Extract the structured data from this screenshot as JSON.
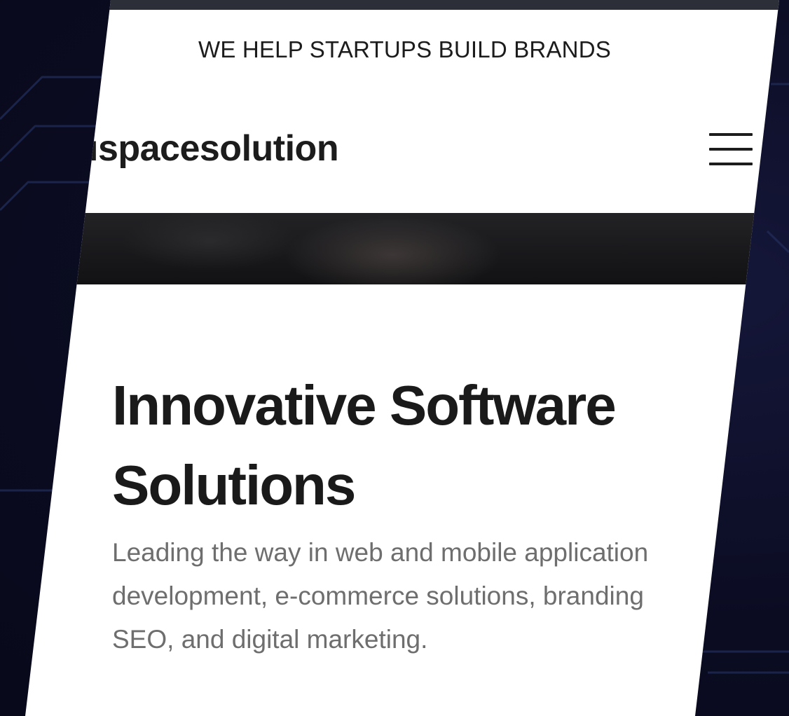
{
  "header": {
    "tagline": "WE HELP STARTUPS BUILD BRANDS",
    "brand_name": "ıspacesolution",
    "menu_icon": "hamburger-menu-icon"
  },
  "hero": {
    "title": "Innovative Software Solutions",
    "description_lines": [
      "Leading the way in web and mobile application",
      "development, e-commerce solutions, branding",
      "SEO, and digital marketing."
    ]
  },
  "colors": {
    "background": "#0b0c22",
    "page": "#ffffff",
    "text_dark": "#1c1c1c",
    "text_muted": "#6e6e6e"
  }
}
